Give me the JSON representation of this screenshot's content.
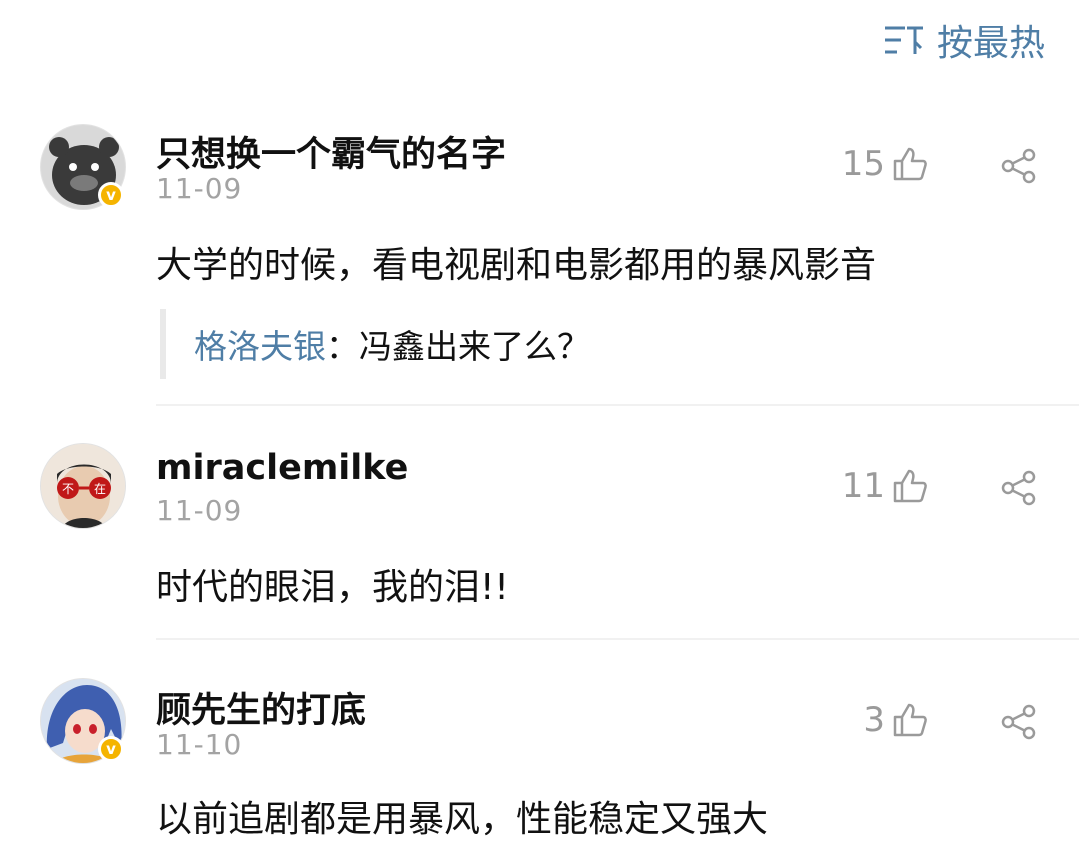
{
  "sort": {
    "label": "按最热",
    "icon": "sort-icon"
  },
  "colors": {
    "link": "#4f7ea6",
    "muted": "#9a9a9a",
    "badge": "#f5b400"
  },
  "comments": [
    {
      "username": "只想换一个霸气的名字",
      "date": "11-09",
      "likes": "15",
      "verified": true,
      "text": "大学的时候，看电视剧和电影都用的暴风影音",
      "reply": {
        "user": "格洛夫银",
        "text": "：冯鑫出来了么？"
      }
    },
    {
      "username": "miraclemilke",
      "date": "11-09",
      "likes": "11",
      "verified": false,
      "text": "时代的眼泪，我的泪!!",
      "avatar_text": [
        "不",
        "在"
      ]
    },
    {
      "username": "顾先生的打底",
      "date": "11-10",
      "likes": "3",
      "verified": true,
      "text": "以前追剧都是用暴风，性能稳定又强大"
    }
  ]
}
